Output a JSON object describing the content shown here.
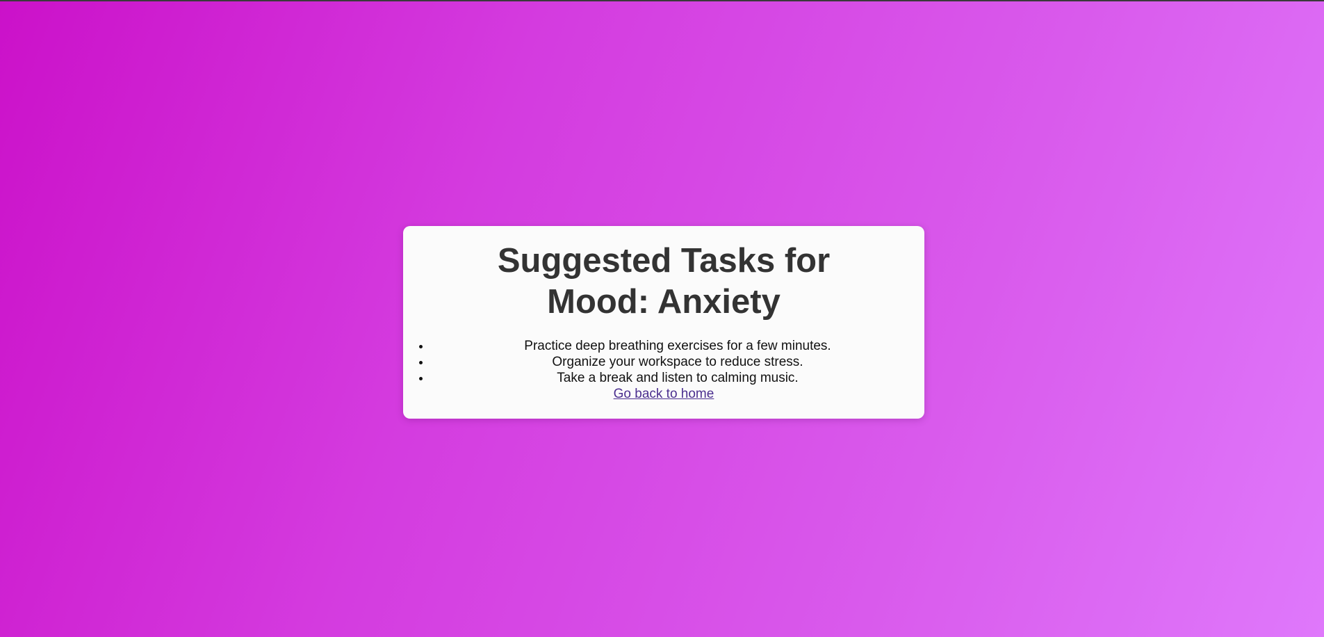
{
  "page": {
    "title_line": "Suggested Tasks for Mood: Anxiety"
  },
  "tasks": [
    "Practice deep breathing exercises for a few minutes.",
    "Organize your workspace to reduce stress.",
    "Take a break and listen to calming music."
  ],
  "link": {
    "label": "Go back to home"
  },
  "colors": {
    "gradient_start": "#cb11c9",
    "gradient_end": "#df78fb",
    "card_background": "#fbfbfb",
    "title_text": "#333333",
    "link_text": "#4b2f8f"
  }
}
